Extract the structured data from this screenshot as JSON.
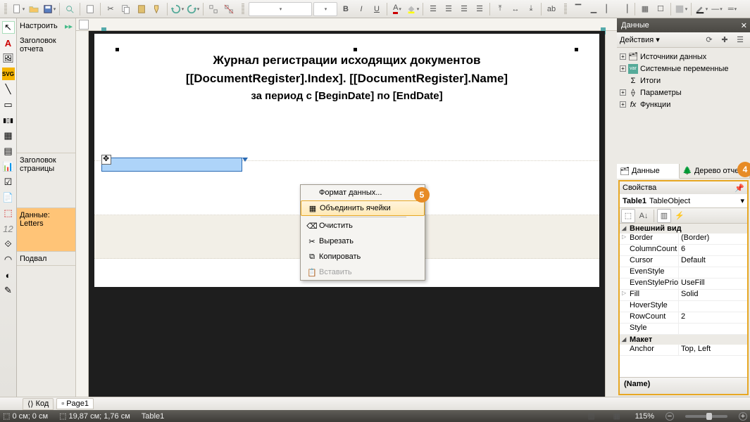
{
  "toolbarTop": {},
  "leftPanel": {
    "configure": "Настроить"
  },
  "bands": {
    "reportTitle": "Заголовок отчета",
    "pageHeader": "Заголовок страницы",
    "data": "Данные: Letters",
    "footer": "Подвал"
  },
  "report": {
    "line1": "Журнал регистрации исходящих документов",
    "line2": "[[DocumentRegister].Index]. [[DocumentRegister].Name]",
    "line3": "за период с [BeginDate] по [EndDate]"
  },
  "contextMenu": {
    "formatData": "Формат данных...",
    "mergeCells": "Объединить ячейки",
    "clear": "Очистить",
    "cut": "Вырезать",
    "copy": "Копировать",
    "paste": "Вставить"
  },
  "callouts": {
    "c4": "4",
    "c5": "5"
  },
  "dataPanel": {
    "title": "Данные",
    "actions": "Действия",
    "tree": {
      "sources": "Источники данных",
      "sysvars": "Системные переменные",
      "totals": "Итоги",
      "params": "Параметры",
      "funcs": "Функции"
    },
    "tabs": {
      "data": "Данные",
      "tree": "Дерево отчета"
    }
  },
  "props": {
    "title": "Свойства",
    "objName": "Table1",
    "objType": "TableObject",
    "catAppearance": "Внешний вид",
    "catLayout": "Макет",
    "rows": [
      {
        "k": "Border",
        "v": "(Border)"
      },
      {
        "k": "ColumnCount",
        "v": "6"
      },
      {
        "k": "Cursor",
        "v": "Default"
      },
      {
        "k": "EvenStyle",
        "v": ""
      },
      {
        "k": "EvenStylePriority",
        "v": "UseFill"
      },
      {
        "k": "Fill",
        "v": "Solid"
      },
      {
        "k": "HoverStyle",
        "v": ""
      },
      {
        "k": "RowCount",
        "v": "2"
      },
      {
        "k": "Style",
        "v": ""
      }
    ],
    "layoutRows": [
      {
        "k": "Anchor",
        "v": "Top, Left"
      }
    ],
    "footer": "(Name)"
  },
  "bottomTabs": {
    "code": "Код",
    "page1": "Page1"
  },
  "status": {
    "pos": "0 см; 0 см",
    "sel": "19,87 см; 1,76 см",
    "obj": "Table1",
    "zoom": "115%"
  }
}
